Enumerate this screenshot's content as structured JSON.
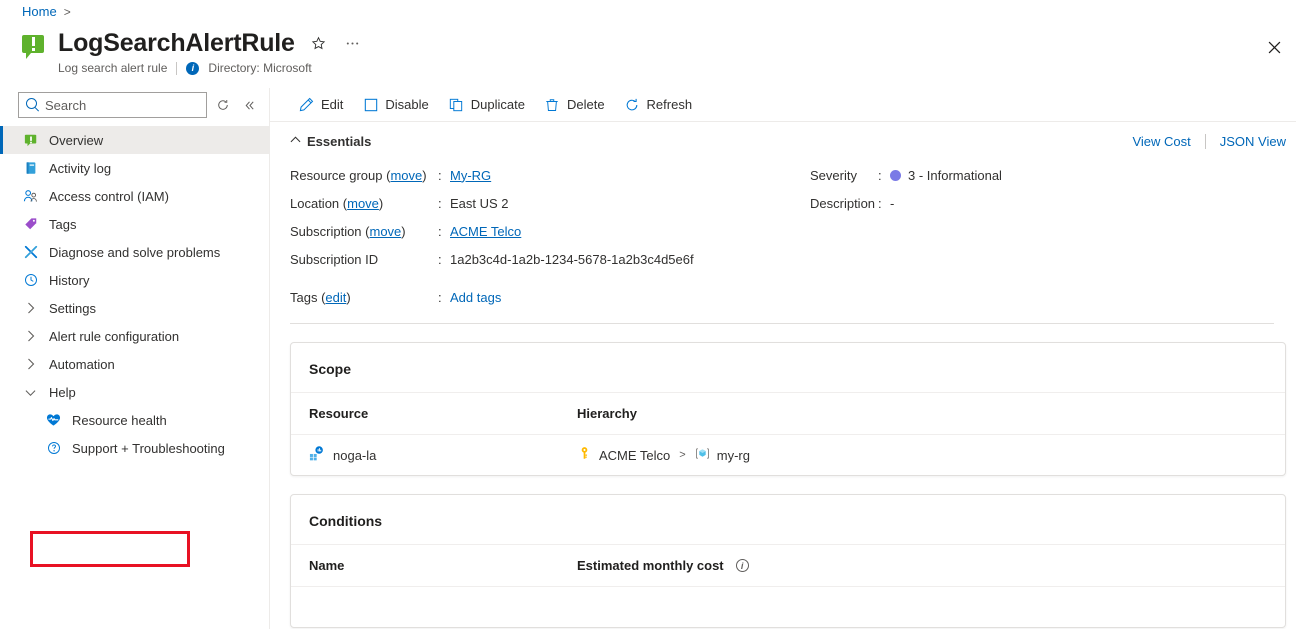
{
  "breadcrumb": {
    "items": [
      "Home"
    ],
    "separator": ">"
  },
  "header": {
    "title": "LogSearchAlertRule",
    "subtitle": "Log search alert rule",
    "directory": "Directory: Microsoft",
    "favorite_icon": "star-icon",
    "more_icon": "ellipsis-icon",
    "close_icon": "close-icon"
  },
  "sidebar": {
    "search": {
      "placeholder": "Search",
      "value": ""
    },
    "refresh_icon": "refresh-icon",
    "collapse_icon": "double-chevron-left-icon",
    "items": [
      {
        "label": "Overview",
        "icon": "alert-rule-icon",
        "type": "leaf",
        "selected": true
      },
      {
        "label": "Activity log",
        "icon": "activity-log-icon",
        "type": "leaf",
        "selected": false
      },
      {
        "label": "Access control (IAM)",
        "icon": "people-icon",
        "type": "leaf",
        "selected": false
      },
      {
        "label": "Tags",
        "icon": "tag-icon",
        "type": "leaf",
        "selected": false
      },
      {
        "label": "Diagnose and solve problems",
        "icon": "wrench-icon",
        "type": "leaf",
        "selected": false
      },
      {
        "label": "History",
        "icon": "clock-icon",
        "type": "leaf",
        "selected": false
      },
      {
        "label": "Settings",
        "icon": "chevron-right-icon",
        "type": "group",
        "expanded": false
      },
      {
        "label": "Alert rule configuration",
        "icon": "chevron-right-icon",
        "type": "group",
        "expanded": false
      },
      {
        "label": "Automation",
        "icon": "chevron-right-icon",
        "type": "group",
        "expanded": false
      },
      {
        "label": "Help",
        "icon": "chevron-down-icon",
        "type": "group",
        "expanded": true
      },
      {
        "label": "Resource health",
        "icon": "heart-pulse-icon",
        "type": "sub",
        "highlighted": true
      },
      {
        "label": "Support + Troubleshooting",
        "icon": "question-circle-icon",
        "type": "sub",
        "highlighted": false
      }
    ],
    "highlight_color": "#e81123"
  },
  "toolbar": {
    "commands": [
      {
        "label": "Edit",
        "icon": "pencil-icon"
      },
      {
        "label": "Disable",
        "icon": "square-icon"
      },
      {
        "label": "Duplicate",
        "icon": "copy-icon"
      },
      {
        "label": "Delete",
        "icon": "trash-icon"
      },
      {
        "label": "Refresh",
        "icon": "refresh-icon"
      }
    ]
  },
  "essentials": {
    "heading": "Essentials",
    "caret_icon": "chevron-up-icon",
    "view_cost": "View Cost",
    "json_view": "JSON View",
    "left": [
      {
        "label": "Resource group",
        "move": "move",
        "colon": ":",
        "value": "My-RG",
        "is_link": true
      },
      {
        "label": "Location",
        "move": "move",
        "colon": ":",
        "value": "East US 2",
        "is_link": false
      },
      {
        "label": "Subscription",
        "move": "move",
        "colon": ":",
        "value": "ACME Telco",
        "is_link": true
      },
      {
        "label": "Subscription ID",
        "move": "",
        "colon": ":",
        "value": "1a2b3c4d-1a2b-1234-5678-1a2b3c4d5e6f",
        "is_link": false
      }
    ],
    "right": [
      {
        "label": "Severity",
        "colon": ":",
        "value": "3 - Informational",
        "dot_color": "#7a7ae6"
      },
      {
        "label": "Description",
        "colon": ":",
        "value": "-",
        "dot_color": ""
      }
    ],
    "tags": {
      "label": "Tags",
      "edit": "edit",
      "colon": ":",
      "value": "Add tags"
    }
  },
  "scope_card": {
    "title": "Scope",
    "columns": [
      "Resource",
      "Hierarchy"
    ],
    "rows": [
      {
        "resource": "noga-la",
        "resource_icon": "log-analytics-icon",
        "hierarchy": [
          {
            "text": "ACME Telco",
            "icon": "key-icon"
          },
          {
            "text": "my-rg",
            "icon": "resource-group-icon"
          }
        ],
        "hierarchy_separator": ">"
      }
    ]
  },
  "conditions_card": {
    "title": "Conditions",
    "columns": [
      "Name",
      "Estimated monthly cost"
    ],
    "info_icon": "info-circle-icon",
    "rows": [
      {
        "name": "",
        "cost": ""
      }
    ]
  },
  "colors": {
    "accent": "#0067b8",
    "selected_bg": "#edebe9",
    "highlight": "#e81123",
    "severity": "#7a7ae6",
    "alert_green": "#5fb22d"
  }
}
